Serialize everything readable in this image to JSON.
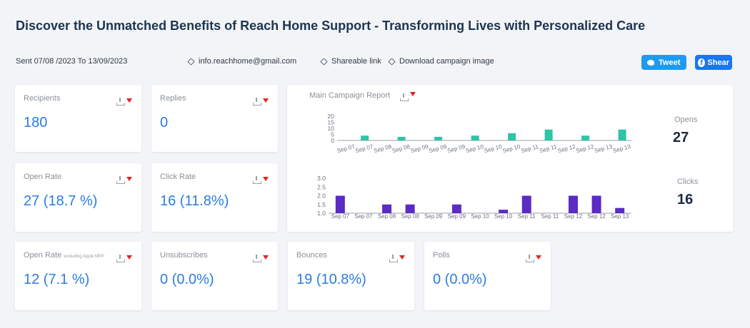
{
  "header": {
    "title": "Discover the Unmatched Benefits of Reach Home Support - Transforming Lives with Personalized Care",
    "sent_range": "Sent 07/08 /2023 To 13/09/2023",
    "email": "info.reachhome@gmail.com",
    "shareable_link": "Shareable link",
    "download_image": "Download campaign image",
    "tweet_label": "Tweet",
    "share_label": "Shear"
  },
  "cards": {
    "recipients": {
      "label": "Recipients",
      "value": "180"
    },
    "replies": {
      "label": "Replies",
      "value": "0"
    },
    "open_rate": {
      "label": "Open Rate",
      "value": "27 (18.7 %)"
    },
    "click_rate": {
      "label": "Click Rate",
      "value": "16 (11.8%)"
    },
    "open_rate_excl": {
      "label": "Open Rate",
      "note": "excluding Apple MPP",
      "value": "12 (7.1 %)"
    },
    "unsubscribes": {
      "label": "Unsubscribes",
      "value": "0 (0.0%)"
    },
    "bounces": {
      "label": "Bounces",
      "value": "19  (10.8%)"
    },
    "polls": {
      "label": "Polls",
      "value": "0 (0.0%)"
    }
  },
  "report": {
    "title": "Main Campaign Report",
    "opens_label": "Opens",
    "opens_value": "27",
    "clicks_label": "Clicks",
    "clicks_value": "16"
  },
  "colors": {
    "opens": "#2ec4a8",
    "clicks": "#5b2bc4",
    "accent": "#2a7de1",
    "tweet": "#1d9bf0",
    "facebook": "#1877f2"
  },
  "chart_data": [
    {
      "type": "bar",
      "name": "opens",
      "categories": [
        "Sep 07",
        "Sep 07",
        "Sep 08",
        "Sep 08",
        "Sep 09",
        "Sep 09",
        "Sep 09",
        "Sep 10",
        "Sep 10",
        "Sep 10",
        "Sep 11",
        "Sep 11",
        "Sep 12",
        "Sep 12",
        "Sep 13",
        "Sep 13"
      ],
      "values": [
        0,
        4,
        0,
        3,
        0,
        3,
        0,
        4,
        0,
        6,
        0,
        9,
        0,
        4,
        0,
        9
      ],
      "yticks": [
        0,
        5,
        10,
        15,
        20
      ],
      "ylim": [
        0,
        20
      ]
    },
    {
      "type": "bar",
      "name": "clicks",
      "categories": [
        "Sep 07",
        "Sep 07",
        "Sep 08",
        "Sep 08",
        "Sep 09",
        "Sep 09",
        "Sep 10",
        "Sep 10",
        "Sep 11",
        "Sep 11",
        "Sep 12",
        "Sep 12",
        "Sep 13"
      ],
      "values": [
        2,
        0,
        1.5,
        1.5,
        0,
        1.5,
        0,
        1.2,
        2,
        0,
        2,
        2,
        1.3
      ],
      "yticks": [
        1.0,
        1.5,
        2.0,
        2.5,
        3.0
      ],
      "ylim": [
        1.0,
        3.0
      ]
    }
  ]
}
